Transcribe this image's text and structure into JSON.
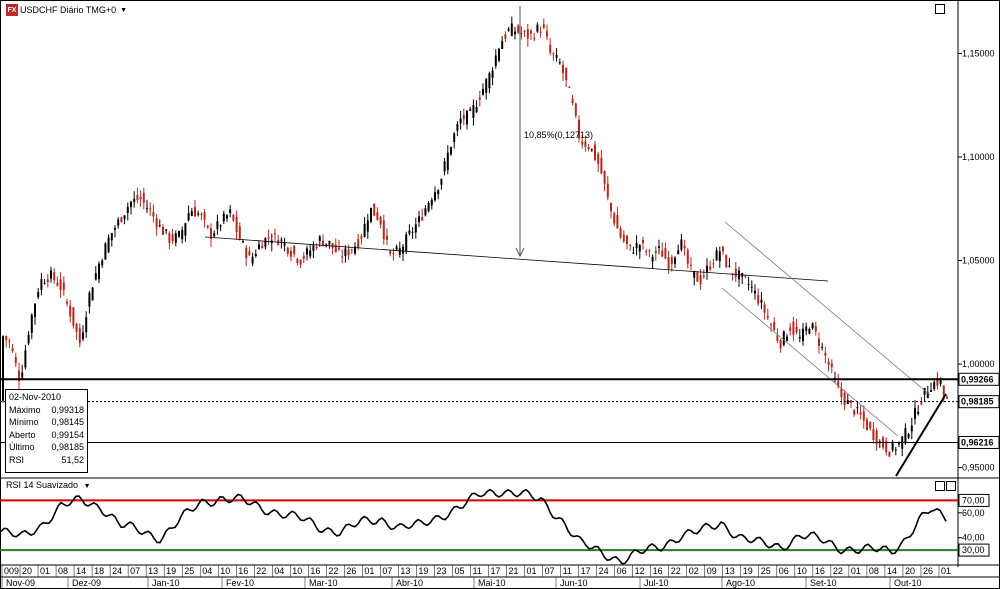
{
  "header": {
    "logo_text": "FX",
    "title": "USDCHF Diário TMG+0"
  },
  "rsi_panel": {
    "title": "RSI 14 Suavizado"
  },
  "info_box": {
    "date": "02-Nov-2010",
    "rows": [
      {
        "label": "Máximo",
        "value": "0,99318"
      },
      {
        "label": "Mínimo",
        "value": "0,98145"
      },
      {
        "label": "Aberto",
        "value": "0,99154"
      },
      {
        "label": "Último",
        "value": "0,98185"
      },
      {
        "label": "RSI",
        "value": "51,52"
      }
    ]
  },
  "chart_data": [
    {
      "type": "candlestick",
      "symbol": "USDCHF",
      "y_ticks": [
        "1,15000",
        "1,10000",
        "1,05000",
        "1,00000",
        "0,95000"
      ],
      "ylim": [
        0.945,
        1.17
      ],
      "price_labels": [
        {
          "value": 0.99266,
          "text": "0,99266",
          "style": "solid",
          "color": "#000000"
        },
        {
          "value": 0.98185,
          "text": "0,98185",
          "style": "dotted",
          "color": "#000000"
        },
        {
          "value": 0.96216,
          "text": "0,96216",
          "style": "thin",
          "color": "#000000"
        }
      ],
      "annotation": "10,85%(0,12713)",
      "x_major_labels": [
        "Nov-09",
        "Dez-09",
        "Jan-10",
        "Fev-10",
        "Mar-10",
        "Abr-10",
        "Mai-10",
        "Jun-10",
        "Jul-10",
        "Ago-10",
        "Set-10",
        "Out-10"
      ],
      "x_minor_labels": [
        "009",
        "20",
        "01",
        "08",
        "14",
        "18",
        "24",
        "07",
        "13",
        "19",
        "25",
        "04",
        "10",
        "16",
        "22",
        "04",
        "10",
        "16",
        "22",
        "26",
        "01",
        "07",
        "13",
        "19",
        "23",
        "05",
        "11",
        "17",
        "21",
        "01",
        "07",
        "11",
        "17",
        "24",
        "06",
        "12",
        "16",
        "22",
        "02",
        "09",
        "13",
        "19",
        "25",
        "06",
        "10",
        "16",
        "22",
        "01",
        "08",
        "14",
        "20",
        "26",
        "01"
      ],
      "series": [
        {
          "name": "USDCHF",
          "anchors": [
            [
              0,
              1.015
            ],
            [
              10,
              1.01
            ],
            [
              20,
              0.992
            ],
            [
              30,
              1.02
            ],
            [
              40,
              1.04
            ],
            [
              50,
              1.043
            ],
            [
              60,
              1.038
            ],
            [
              70,
              1.025
            ],
            [
              80,
              1.01
            ],
            [
              90,
              1.035
            ],
            [
              100,
              1.05
            ],
            [
              110,
              1.062
            ],
            [
              120,
              1.07
            ],
            [
              130,
              1.078
            ],
            [
              140,
              1.08
            ],
            [
              150,
              1.074
            ],
            [
              160,
              1.066
            ],
            [
              170,
              1.06
            ],
            [
              180,
              1.062
            ],
            [
              190,
              1.075
            ],
            [
              200,
              1.072
            ],
            [
              210,
              1.062
            ],
            [
              220,
              1.068
            ],
            [
              230,
              1.073
            ],
            [
              240,
              1.06
            ],
            [
              250,
              1.05
            ],
            [
              260,
              1.058
            ],
            [
              270,
              1.062
            ],
            [
              280,
              1.06
            ],
            [
              290,
              1.055
            ],
            [
              300,
              1.05
            ],
            [
              310,
              1.055
            ],
            [
              320,
              1.06
            ],
            [
              330,
              1.058
            ],
            [
              340,
              1.052
            ],
            [
              350,
              1.055
            ],
            [
              360,
              1.06
            ],
            [
              370,
              1.075
            ],
            [
              380,
              1.07
            ],
            [
              390,
              1.052
            ],
            [
              400,
              1.055
            ],
            [
              410,
              1.063
            ],
            [
              420,
              1.07
            ],
            [
              430,
              1.08
            ],
            [
              440,
              1.088
            ],
            [
              450,
              1.105
            ],
            [
              460,
              1.118
            ],
            [
              470,
              1.12
            ],
            [
              480,
              1.13
            ],
            [
              490,
              1.14
            ],
            [
              500,
              1.155
            ],
            [
              510,
              1.162
            ],
            [
              520,
              1.16
            ],
            [
              530,
              1.158
            ],
            [
              540,
              1.163
            ],
            [
              545,
              1.16
            ],
            [
              550,
              1.15
            ],
            [
              560,
              1.145
            ],
            [
              570,
              1.13
            ],
            [
              580,
              1.108
            ],
            [
              590,
              1.105
            ],
            [
              600,
              1.095
            ],
            [
              610,
              1.075
            ],
            [
              620,
              1.062
            ],
            [
              630,
              1.055
            ],
            [
              640,
              1.058
            ],
            [
              650,
              1.052
            ],
            [
              660,
              1.055
            ],
            [
              670,
              1.048
            ],
            [
              680,
              1.06
            ],
            [
              690,
              1.045
            ],
            [
              700,
              1.04
            ],
            [
              710,
              1.048
            ],
            [
              720,
              1.055
            ],
            [
              730,
              1.045
            ],
            [
              740,
              1.042
            ],
            [
              750,
              1.038
            ],
            [
              760,
              1.03
            ],
            [
              770,
              1.02
            ],
            [
              780,
              1.01
            ],
            [
              790,
              1.018
            ],
            [
              800,
              1.012
            ],
            [
              810,
              1.02
            ],
            [
              820,
              1.01
            ],
            [
              830,
              0.998
            ],
            [
              840,
              0.985
            ],
            [
              850,
              0.98
            ],
            [
              860,
              0.975
            ],
            [
              870,
              0.968
            ],
            [
              880,
              0.962
            ],
            [
              890,
              0.958
            ],
            [
              900,
              0.962
            ],
            [
              910,
              0.97
            ],
            [
              920,
              0.982
            ],
            [
              930,
              0.99
            ],
            [
              940,
              0.992
            ],
            [
              945,
              0.982
            ]
          ]
        }
      ]
    },
    {
      "type": "line",
      "title": "RSI 14 Suavizado",
      "y_ticks": [
        "70,00",
        "60,00",
        "40,00",
        "30,00"
      ],
      "ylim": [
        18,
        80
      ],
      "levels": [
        {
          "value": 70,
          "color": "#d00000"
        },
        {
          "value": 30,
          "color": "#2a7a2a"
        }
      ],
      "series": [
        {
          "name": "RSI",
          "anchors": [
            [
              0,
              45
            ],
            [
              20,
              40
            ],
            [
              40,
              50
            ],
            [
              60,
              65
            ],
            [
              80,
              70
            ],
            [
              100,
              65
            ],
            [
              120,
              50
            ],
            [
              140,
              45
            ],
            [
              160,
              40
            ],
            [
              180,
              55
            ],
            [
              200,
              68
            ],
            [
              220,
              72
            ],
            [
              240,
              70
            ],
            [
              260,
              64
            ],
            [
              280,
              60
            ],
            [
              300,
              55
            ],
            [
              320,
              48
            ],
            [
              340,
              45
            ],
            [
              360,
              52
            ],
            [
              380,
              55
            ],
            [
              400,
              48
            ],
            [
              420,
              50
            ],
            [
              440,
              58
            ],
            [
              460,
              65
            ],
            [
              480,
              75
            ],
            [
              500,
              78
            ],
            [
              520,
              75
            ],
            [
              540,
              70
            ],
            [
              560,
              55
            ],
            [
              580,
              35
            ],
            [
              600,
              28
            ],
            [
              620,
              22
            ],
            [
              640,
              28
            ],
            [
              660,
              33
            ],
            [
              680,
              42
            ],
            [
              700,
              45
            ],
            [
              720,
              52
            ],
            [
              740,
              40
            ],
            [
              760,
              35
            ],
            [
              780,
              33
            ],
            [
              800,
              42
            ],
            [
              820,
              38
            ],
            [
              840,
              32
            ],
            [
              860,
              30
            ],
            [
              880,
              30
            ],
            [
              890,
              30
            ],
            [
              900,
              35
            ],
            [
              910,
              45
            ],
            [
              920,
              55
            ],
            [
              930,
              62
            ],
            [
              945,
              56
            ]
          ]
        }
      ]
    }
  ],
  "colors": {
    "up": "#000000",
    "down": "#b5281e",
    "resistance_line": "#000000",
    "overbought": "#d00000",
    "oversold": "#2a7a2a"
  }
}
